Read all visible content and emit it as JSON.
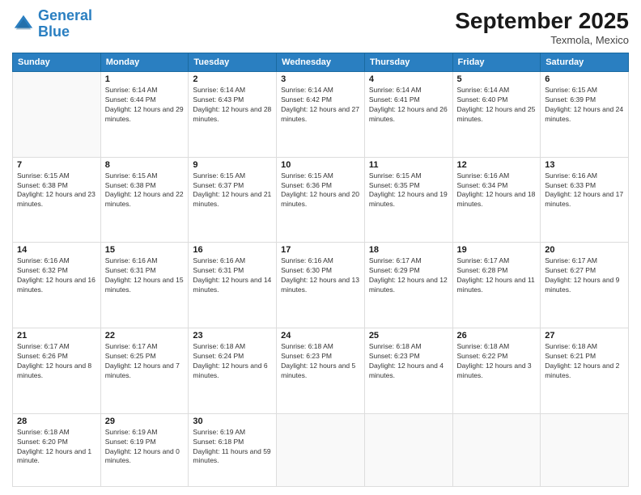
{
  "logo": {
    "line1": "General",
    "line2": "Blue"
  },
  "title": "September 2025",
  "location": "Texmola, Mexico",
  "days_of_week": [
    "Sunday",
    "Monday",
    "Tuesday",
    "Wednesday",
    "Thursday",
    "Friday",
    "Saturday"
  ],
  "weeks": [
    [
      {
        "num": "",
        "empty": true
      },
      {
        "num": "1",
        "sunrise": "6:14 AM",
        "sunset": "6:44 PM",
        "daylight": "12 hours and 29 minutes."
      },
      {
        "num": "2",
        "sunrise": "6:14 AM",
        "sunset": "6:43 PM",
        "daylight": "12 hours and 28 minutes."
      },
      {
        "num": "3",
        "sunrise": "6:14 AM",
        "sunset": "6:42 PM",
        "daylight": "12 hours and 27 minutes."
      },
      {
        "num": "4",
        "sunrise": "6:14 AM",
        "sunset": "6:41 PM",
        "daylight": "12 hours and 26 minutes."
      },
      {
        "num": "5",
        "sunrise": "6:14 AM",
        "sunset": "6:40 PM",
        "daylight": "12 hours and 25 minutes."
      },
      {
        "num": "6",
        "sunrise": "6:15 AM",
        "sunset": "6:39 PM",
        "daylight": "12 hours and 24 minutes."
      }
    ],
    [
      {
        "num": "7",
        "sunrise": "6:15 AM",
        "sunset": "6:38 PM",
        "daylight": "12 hours and 23 minutes."
      },
      {
        "num": "8",
        "sunrise": "6:15 AM",
        "sunset": "6:38 PM",
        "daylight": "12 hours and 22 minutes."
      },
      {
        "num": "9",
        "sunrise": "6:15 AM",
        "sunset": "6:37 PM",
        "daylight": "12 hours and 21 minutes."
      },
      {
        "num": "10",
        "sunrise": "6:15 AM",
        "sunset": "6:36 PM",
        "daylight": "12 hours and 20 minutes."
      },
      {
        "num": "11",
        "sunrise": "6:15 AM",
        "sunset": "6:35 PM",
        "daylight": "12 hours and 19 minutes."
      },
      {
        "num": "12",
        "sunrise": "6:16 AM",
        "sunset": "6:34 PM",
        "daylight": "12 hours and 18 minutes."
      },
      {
        "num": "13",
        "sunrise": "6:16 AM",
        "sunset": "6:33 PM",
        "daylight": "12 hours and 17 minutes."
      }
    ],
    [
      {
        "num": "14",
        "sunrise": "6:16 AM",
        "sunset": "6:32 PM",
        "daylight": "12 hours and 16 minutes."
      },
      {
        "num": "15",
        "sunrise": "6:16 AM",
        "sunset": "6:31 PM",
        "daylight": "12 hours and 15 minutes."
      },
      {
        "num": "16",
        "sunrise": "6:16 AM",
        "sunset": "6:31 PM",
        "daylight": "12 hours and 14 minutes."
      },
      {
        "num": "17",
        "sunrise": "6:16 AM",
        "sunset": "6:30 PM",
        "daylight": "12 hours and 13 minutes."
      },
      {
        "num": "18",
        "sunrise": "6:17 AM",
        "sunset": "6:29 PM",
        "daylight": "12 hours and 12 minutes."
      },
      {
        "num": "19",
        "sunrise": "6:17 AM",
        "sunset": "6:28 PM",
        "daylight": "12 hours and 11 minutes."
      },
      {
        "num": "20",
        "sunrise": "6:17 AM",
        "sunset": "6:27 PM",
        "daylight": "12 hours and 9 minutes."
      }
    ],
    [
      {
        "num": "21",
        "sunrise": "6:17 AM",
        "sunset": "6:26 PM",
        "daylight": "12 hours and 8 minutes."
      },
      {
        "num": "22",
        "sunrise": "6:17 AM",
        "sunset": "6:25 PM",
        "daylight": "12 hours and 7 minutes."
      },
      {
        "num": "23",
        "sunrise": "6:18 AM",
        "sunset": "6:24 PM",
        "daylight": "12 hours and 6 minutes."
      },
      {
        "num": "24",
        "sunrise": "6:18 AM",
        "sunset": "6:23 PM",
        "daylight": "12 hours and 5 minutes."
      },
      {
        "num": "25",
        "sunrise": "6:18 AM",
        "sunset": "6:23 PM",
        "daylight": "12 hours and 4 minutes."
      },
      {
        "num": "26",
        "sunrise": "6:18 AM",
        "sunset": "6:22 PM",
        "daylight": "12 hours and 3 minutes."
      },
      {
        "num": "27",
        "sunrise": "6:18 AM",
        "sunset": "6:21 PM",
        "daylight": "12 hours and 2 minutes."
      }
    ],
    [
      {
        "num": "28",
        "sunrise": "6:18 AM",
        "sunset": "6:20 PM",
        "daylight": "12 hours and 1 minute."
      },
      {
        "num": "29",
        "sunrise": "6:19 AM",
        "sunset": "6:19 PM",
        "daylight": "12 hours and 0 minutes."
      },
      {
        "num": "30",
        "sunrise": "6:19 AM",
        "sunset": "6:18 PM",
        "daylight": "11 hours and 59 minutes."
      },
      {
        "num": "",
        "empty": true
      },
      {
        "num": "",
        "empty": true
      },
      {
        "num": "",
        "empty": true
      },
      {
        "num": "",
        "empty": true
      }
    ]
  ]
}
